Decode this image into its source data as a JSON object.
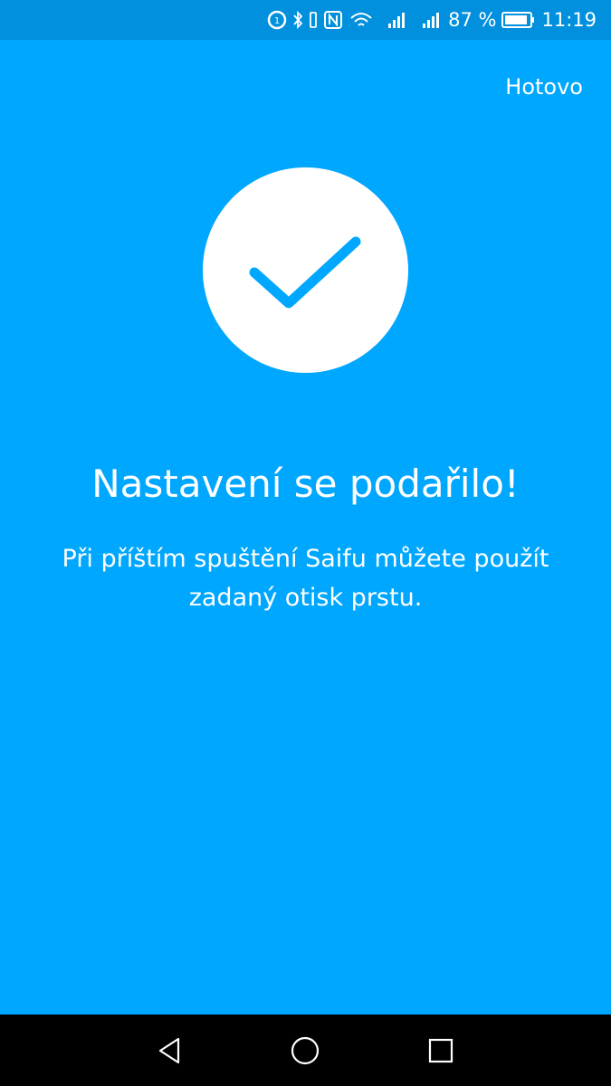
{
  "status_bar": {
    "battery_percent": "87 %",
    "time": "11:19",
    "icons": [
      "data-saver-icon",
      "bluetooth-icon",
      "nfc-icon",
      "wifi-icon",
      "signal-icon",
      "signal-icon",
      "battery-icon"
    ]
  },
  "header": {
    "done_label": "Hotovo"
  },
  "main": {
    "title": "Nastavení se podařilo!",
    "message": "Při příštím spuštění Saifu můžete použít zadaný otisk prstu.",
    "icon": "checkmark-icon"
  },
  "nav": {
    "icons": [
      "back-icon",
      "home-icon",
      "recents-icon"
    ]
  },
  "colors": {
    "background": "#00a7ff",
    "status_bar": "#0090dd",
    "nav_bar": "#000000",
    "text": "#ffffff"
  }
}
